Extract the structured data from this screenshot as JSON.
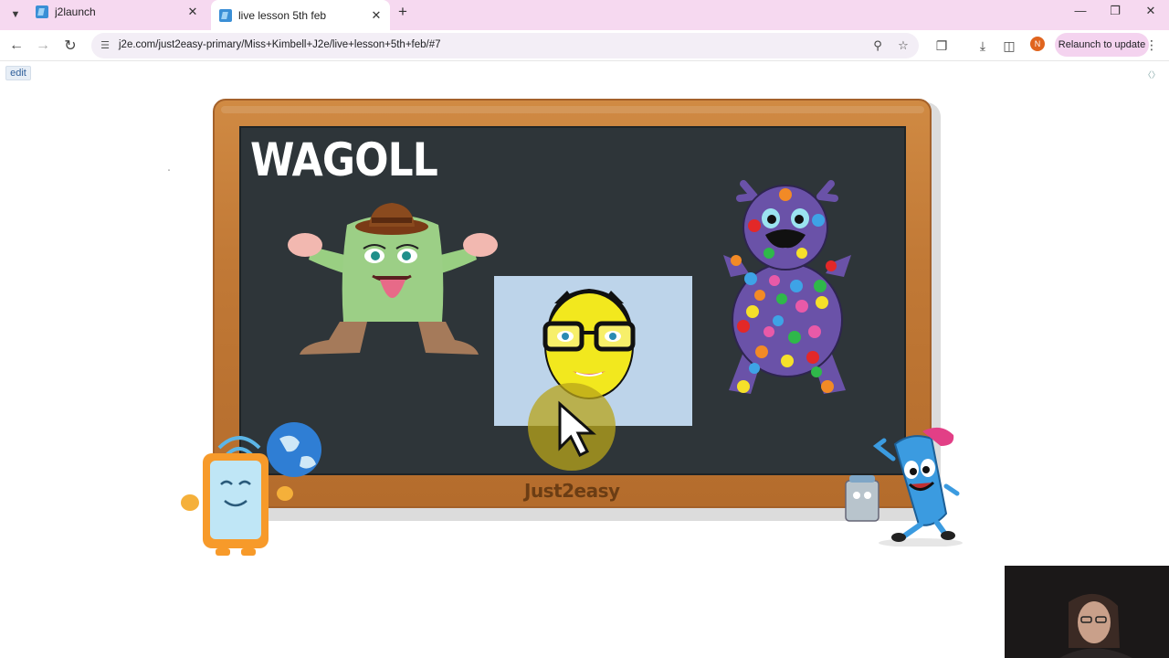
{
  "browser": {
    "tabs": [
      {
        "title": "j2launch",
        "active": false
      },
      {
        "title": "live lesson 5th feb",
        "active": true
      }
    ],
    "url": "j2e.com/just2easy-primary/Miss+Kimbell+J2e/live+lesson+5th+feb/#7",
    "profile_initial": "N",
    "relaunch_label": "Relaunch to update"
  },
  "page": {
    "edit_label": "edit",
    "board_title": "WAGOLL",
    "brand": "Just2easy",
    "tiny_mark": "\""
  },
  "icons": {
    "tab_list": "chevron-down-icon",
    "close": "close-icon",
    "new_tab": "plus-icon",
    "back": "back-arrow-icon",
    "forward": "forward-arrow-icon",
    "reload": "reload-icon",
    "site_info": "tune-icon",
    "zoom": "zoom-icon",
    "bookmark": "star-icon",
    "extensions": "puzzle-icon",
    "downloads": "download-icon",
    "side_panel": "side-panel-icon",
    "menu": "kebab-menu-icon"
  },
  "colors": {
    "tab_strip": "#f6d9f0",
    "board_frame": "#c17936",
    "board_panel": "#2e3539",
    "face_box": "#bdd4ea"
  }
}
